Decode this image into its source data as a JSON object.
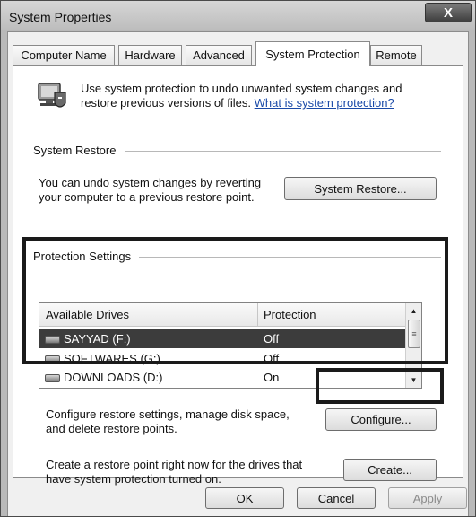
{
  "window": {
    "title": "System Properties",
    "close": "X"
  },
  "tabs": [
    {
      "label": "Computer Name"
    },
    {
      "label": "Hardware"
    },
    {
      "label": "Advanced"
    },
    {
      "label": "System Protection"
    },
    {
      "label": "Remote"
    }
  ],
  "intro": {
    "line1": "Use system protection to undo unwanted system changes and",
    "line2": "restore previous versions of files.",
    "link": "What is system protection?"
  },
  "system_restore": {
    "heading": "System Restore",
    "line1": "You can undo system changes by reverting",
    "line2": "your computer to a previous restore point.",
    "button": "System Restore..."
  },
  "protection": {
    "heading": "Protection Settings",
    "columns": [
      "Available Drives",
      "Protection"
    ],
    "drives": [
      {
        "name": "SAYYAD (F:)",
        "protection": "Off",
        "selected": true
      },
      {
        "name": "SOFTWARES (G:)",
        "protection": "Off",
        "selected": false
      },
      {
        "name": "DOWNLOADS (D:)",
        "protection": "On",
        "selected": false
      }
    ]
  },
  "configure": {
    "line1": "Configure restore settings, manage disk space,",
    "line2": "and delete restore points.",
    "button": "Configure..."
  },
  "create": {
    "line1": "Create a restore point right now for the drives that",
    "line2": "have system protection turned on.",
    "button": "Create..."
  },
  "footer": {
    "ok": "OK",
    "cancel": "Cancel",
    "apply": "Apply"
  },
  "colors": {
    "selection": "#3c3c3c",
    "link": "#1a4aa8",
    "highlight_box": "#1a1a1a"
  }
}
